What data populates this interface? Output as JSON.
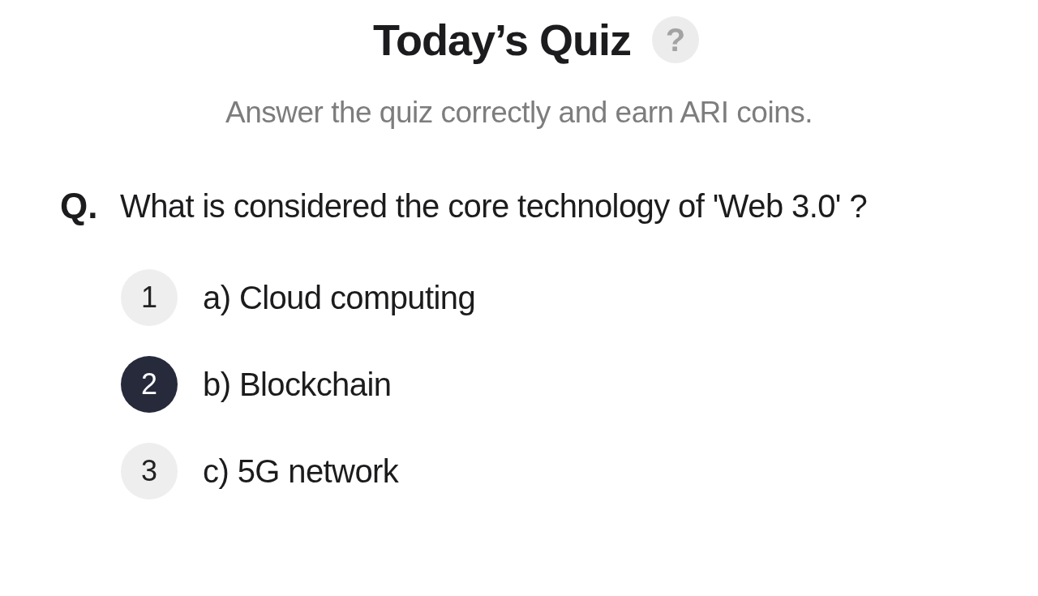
{
  "header": {
    "title": "Today’s Quiz",
    "help": "?",
    "subtitle": "Answer the quiz correctly and earn ARI coins."
  },
  "question": {
    "prefix": "Q.",
    "text": "What is considered the core technology of 'Web 3.0' ?"
  },
  "options": [
    {
      "number": "1",
      "label": "a) Cloud computing",
      "selected": false
    },
    {
      "number": "2",
      "label": "b) Blockchain",
      "selected": true
    },
    {
      "number": "3",
      "label": "c) 5G network",
      "selected": false
    }
  ]
}
